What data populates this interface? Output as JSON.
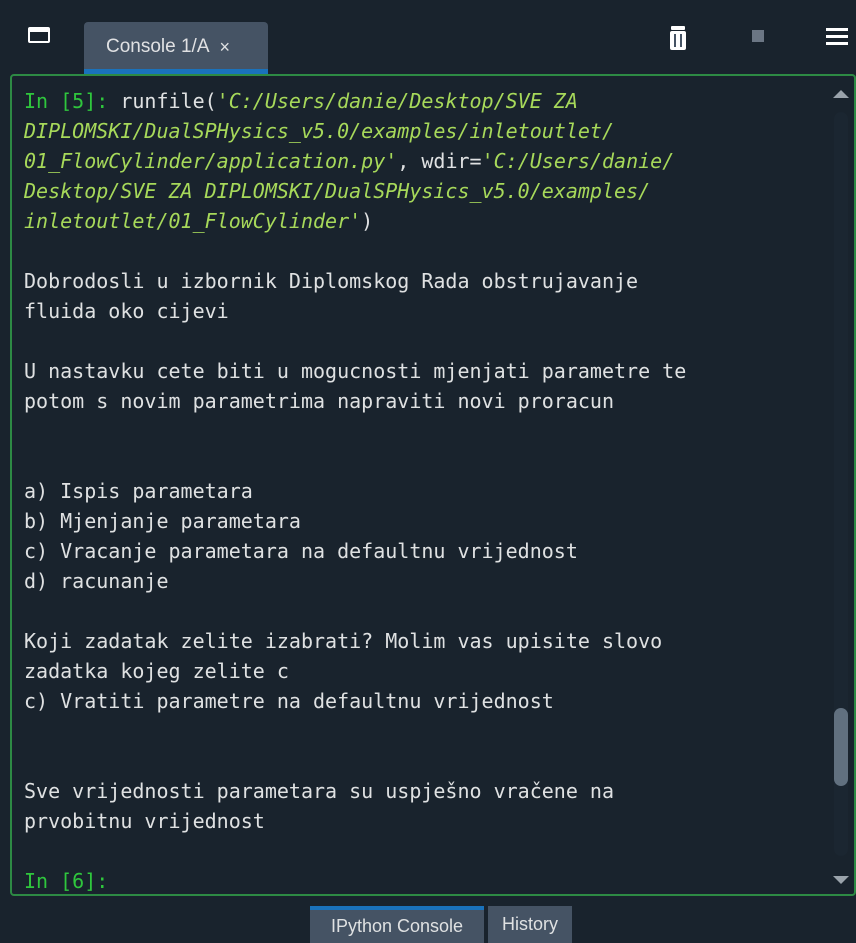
{
  "pane": {
    "tab_label": "Console 1/A",
    "tab_close": "×"
  },
  "console": {
    "lines": [
      [
        {
          "t": "In [5]: ",
          "c": "prompt"
        },
        {
          "t": "runfile(",
          "c": "code"
        },
        {
          "t": "'C:/Users/danie/Desktop/SVE ZA",
          "c": "str"
        }
      ],
      [
        {
          "t": "DIPLOMSKI/DualSPHysics_v5.0/examples/inletoutlet/",
          "c": "str"
        }
      ],
      [
        {
          "t": "01_FlowCylinder/application.py'",
          "c": "str"
        },
        {
          "t": ", wdir=",
          "c": "code"
        },
        {
          "t": "'C:/Users/danie/",
          "c": "str"
        }
      ],
      [
        {
          "t": "Desktop/SVE ZA DIPLOMSKI/DualSPHysics_v5.0/examples/",
          "c": "str"
        }
      ],
      [
        {
          "t": "inletoutlet/01_FlowCylinder'",
          "c": "str"
        },
        {
          "t": ")",
          "c": "code"
        }
      ],
      [],
      [
        {
          "t": "Dobrodosli u izbornik Diplomskog Rada obstrujavanje",
          "c": "code"
        }
      ],
      [
        {
          "t": "fluida oko cijevi",
          "c": "code"
        }
      ],
      [],
      [
        {
          "t": "U nastavku cete biti u mogucnosti mjenjati parametre te",
          "c": "code"
        }
      ],
      [
        {
          "t": "potom s novim parametrima napraviti novi proracun",
          "c": "code"
        }
      ],
      [],
      [],
      [
        {
          "t": "a) Ispis parametara",
          "c": "code"
        }
      ],
      [
        {
          "t": "b) Mjenjanje parametara",
          "c": "code"
        }
      ],
      [
        {
          "t": "c) Vracanje parametara na defaultnu vrijednost",
          "c": "code"
        }
      ],
      [
        {
          "t": "d) racunanje",
          "c": "code"
        }
      ],
      [],
      [
        {
          "t": "Koji zadatak zelite izabrati? Molim vas upisite slovo",
          "c": "code"
        }
      ],
      [
        {
          "t": "zadatka kojeg zelite c",
          "c": "code"
        }
      ],
      [
        {
          "t": "c) Vratiti parametre na defaultnu vrijednost",
          "c": "code"
        }
      ],
      [],
      [],
      [
        {
          "t": "Sve vrijednosti parametara su uspješno vračene na",
          "c": "code"
        }
      ],
      [
        {
          "t": "prvobitnu vrijednost",
          "c": "code"
        }
      ],
      [],
      [
        {
          "t": "In [6]: ",
          "c": "prompt"
        }
      ]
    ]
  },
  "bottom_tabs": [
    {
      "label": "IPython Console",
      "active": true
    },
    {
      "label": "History",
      "active": false
    }
  ],
  "colors": {
    "background": "#19232d",
    "prompt": "#2fc63d",
    "string": "#a7d95a",
    "text": "#dfe1e2",
    "accent": "#1a72bb",
    "focus_border": "#2d8a44"
  },
  "icons": {
    "undock": "undock-icon",
    "trash": "trash-icon",
    "stop": "stop-icon",
    "menu": "hamburger-menu-icon"
  }
}
